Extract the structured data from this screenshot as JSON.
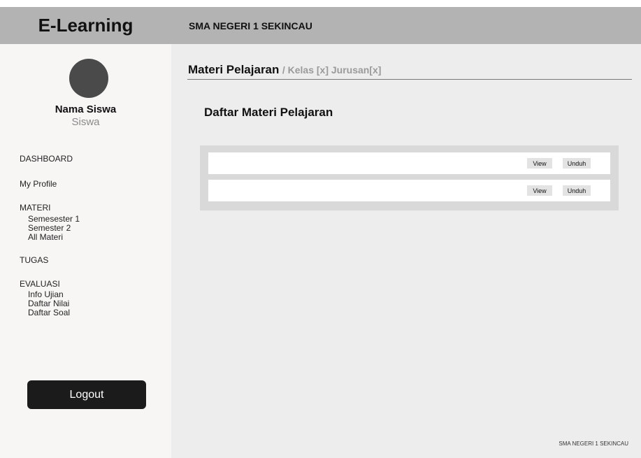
{
  "header": {
    "brand": "E-Learning",
    "school": "SMA NEGERI 1 SEKINCAU"
  },
  "sidebar": {
    "user": {
      "name": "Nama Siswa",
      "role": "Siswa"
    },
    "nav": {
      "dashboard": "DASHBOARD",
      "profile": "My Profile",
      "materi": "MATERI",
      "materi_items": [
        "Semesester 1",
        "Semester 2",
        "All Materi"
      ],
      "tugas": "TUGAS",
      "evaluasi": "EVALUASI",
      "evaluasi_items": [
        "Info Ujian",
        "Daftar Nilai",
        "Daftar Soal"
      ]
    },
    "logout_label": "Logout"
  },
  "main": {
    "title": "Materi Pelajaran",
    "subtitle": "/ Kelas [x] Jurusan[x]",
    "section_title": "Daftar Materi Pelajaran",
    "rows": [
      {
        "view_label": "View",
        "download_label": "Unduh"
      },
      {
        "view_label": "View",
        "download_label": "Unduh"
      }
    ]
  },
  "footer": {
    "text": "SMA NEGERI 1 SEKINCAU"
  },
  "colors": {
    "topbar": "#b3b3b3",
    "sidebar": "#f7f6f4",
    "main": "#ededed",
    "logout_button": "#1b1b1b"
  }
}
